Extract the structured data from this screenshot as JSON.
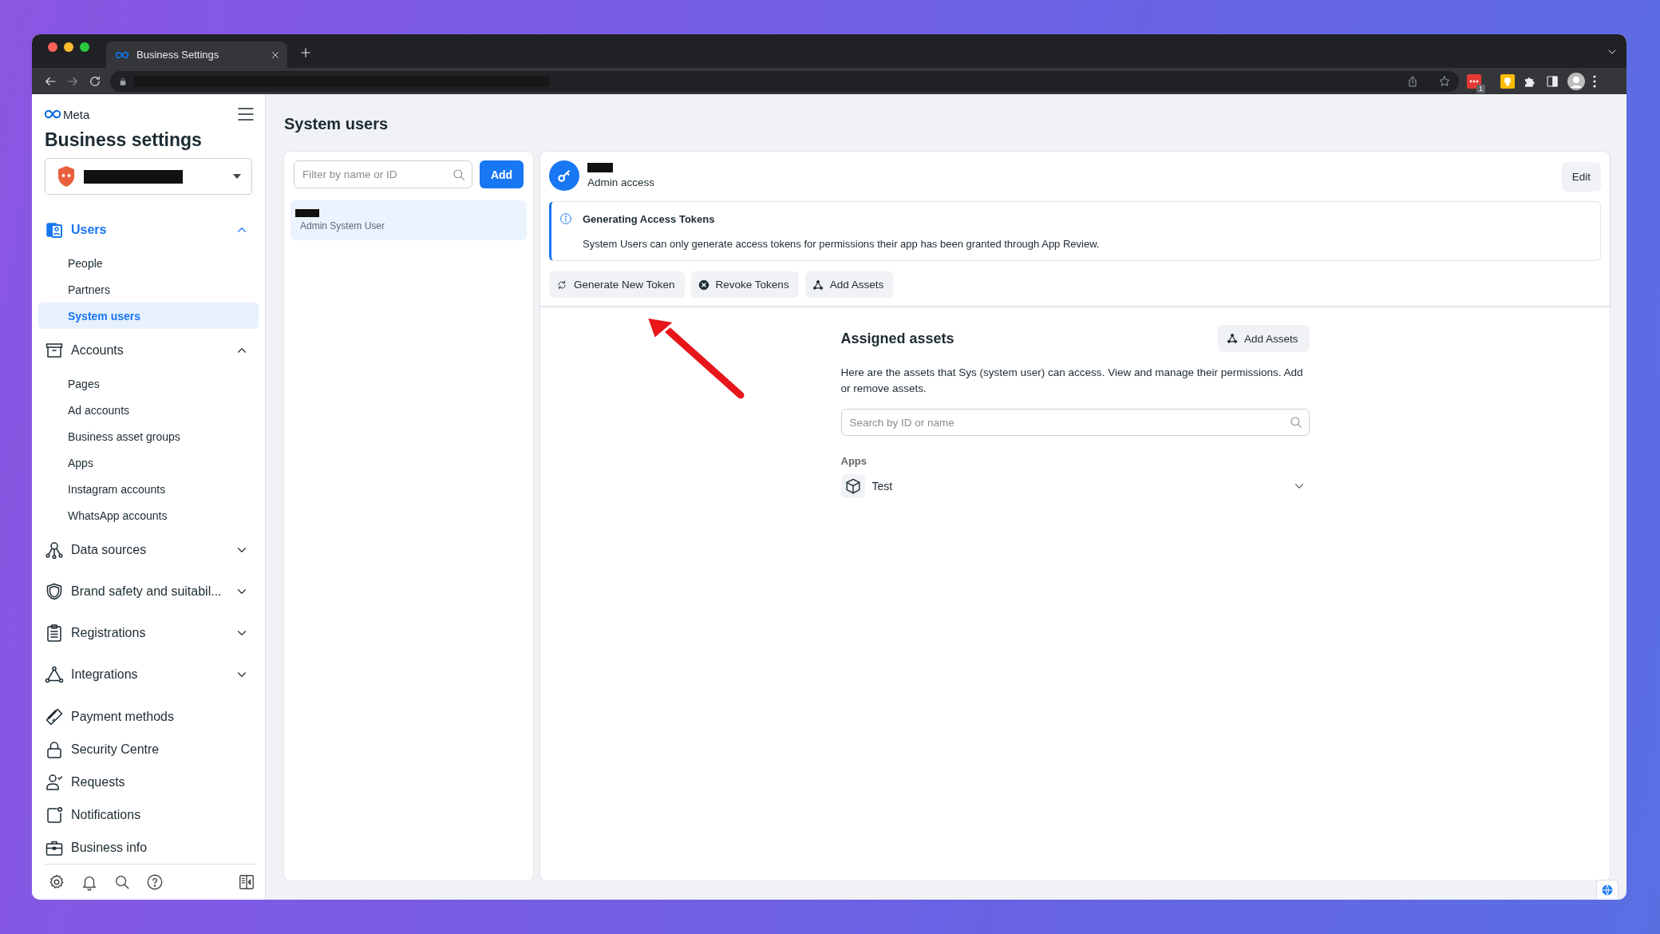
{
  "browser": {
    "tab_title": "Business Settings",
    "extension_badge": "1"
  },
  "sidebar": {
    "brand": "Meta",
    "title": "Business settings",
    "sections": [
      {
        "label": "Users",
        "kind": "group",
        "selected": true,
        "expanded": true,
        "children": [
          {
            "label": "People",
            "selected": false
          },
          {
            "label": "Partners",
            "selected": false
          },
          {
            "label": "System users",
            "selected": true
          }
        ]
      },
      {
        "label": "Accounts",
        "kind": "group",
        "selected": false,
        "expanded": true,
        "children": [
          {
            "label": "Pages",
            "selected": false
          },
          {
            "label": "Ad accounts",
            "selected": false
          },
          {
            "label": "Business asset groups",
            "selected": false
          },
          {
            "label": "Apps",
            "selected": false
          },
          {
            "label": "Instagram accounts",
            "selected": false
          },
          {
            "label": "WhatsApp accounts",
            "selected": false
          }
        ]
      },
      {
        "label": "Data sources",
        "kind": "group",
        "selected": false,
        "expanded": false
      },
      {
        "label": "Brand safety and suitabil...",
        "kind": "group",
        "selected": false,
        "expanded": false
      },
      {
        "label": "Registrations",
        "kind": "group",
        "selected": false,
        "expanded": false
      },
      {
        "label": "Integrations",
        "kind": "group",
        "selected": false,
        "expanded": false
      },
      {
        "label": "Payment methods",
        "kind": "link",
        "selected": false
      },
      {
        "label": "Security Centre",
        "kind": "link",
        "selected": false
      },
      {
        "label": "Requests",
        "kind": "link",
        "selected": false
      },
      {
        "label": "Notifications",
        "kind": "link",
        "selected": false
      },
      {
        "label": "Business info",
        "kind": "link",
        "selected": false
      }
    ]
  },
  "page_title": "System users",
  "user_list": {
    "filter_placeholder": "Filter by name or ID",
    "add_button": "Add",
    "users": [
      {
        "role": "Admin System User",
        "selected": true
      }
    ]
  },
  "detail": {
    "access": "Admin access",
    "edit_button": "Edit",
    "notice": {
      "title": "Generating Access Tokens",
      "text": "System Users can only generate access tokens for permissions their app has been granted through App Review."
    },
    "actions": [
      "Generate New Token",
      "Revoke Tokens",
      "Add Assets"
    ],
    "assets": {
      "title": "Assigned assets",
      "add_button": "Add Assets",
      "description": "Here are the assets that Sys (system user) can access. View and manage their permissions. Add or remove assets.",
      "search_placeholder": "Search by ID or name",
      "groups": [
        {
          "label": "Apps",
          "items": [
            {
              "name": "Test",
              "expanded": false
            }
          ]
        }
      ]
    }
  }
}
